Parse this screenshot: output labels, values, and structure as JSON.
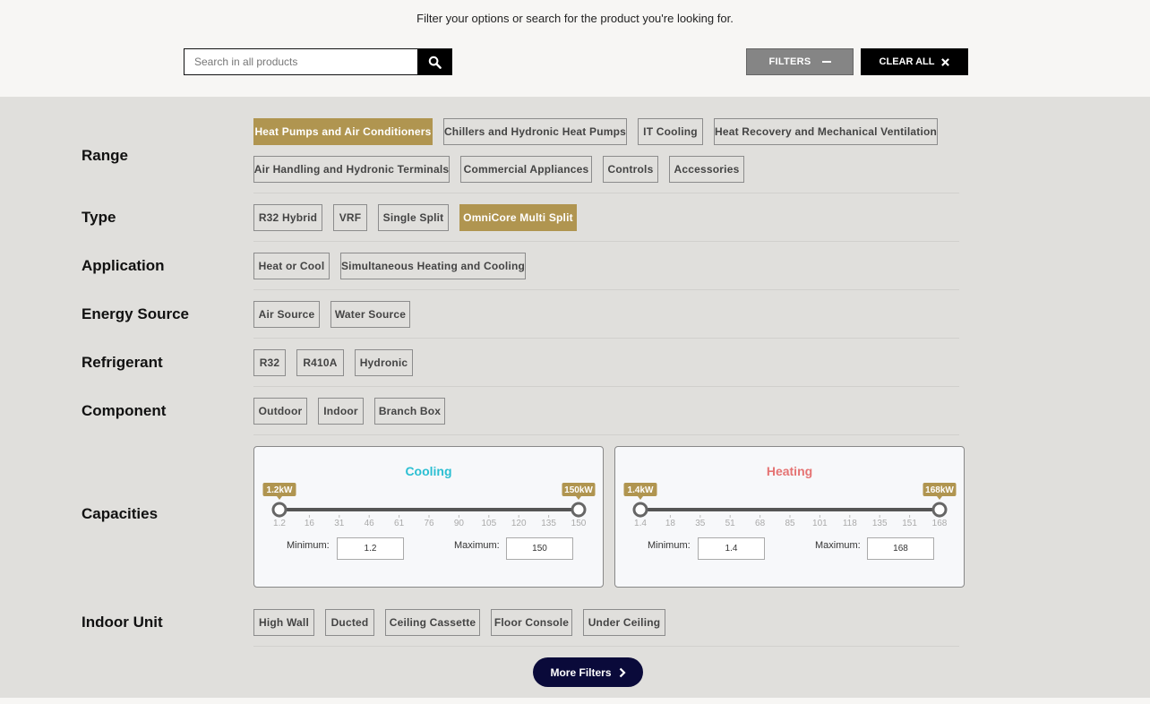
{
  "header": {
    "subtitle": "Filter your options or search for the product you're looking for.",
    "search_placeholder": "Search in all products",
    "search_icon": "search-icon",
    "filters_label": "FILTERS",
    "clear_all_label": "CLEAR ALL"
  },
  "filters": {
    "range": {
      "label": "Range",
      "options": [
        "Heat Pumps and Air Conditioners",
        "Chillers and Hydronic Heat Pumps",
        "IT Cooling",
        "Heat Recovery and Mechanical Ventilation",
        "Air Handling and Hydronic Terminals",
        "Commercial Appliances",
        "Controls",
        "Accessories"
      ],
      "selected": "Heat Pumps and Air Conditioners"
    },
    "type": {
      "label": "Type",
      "options": [
        "R32 Hybrid",
        "VRF",
        "Single Split",
        "OmniCore Multi Split"
      ],
      "selected": "OmniCore Multi Split"
    },
    "application": {
      "label": "Application",
      "options": [
        "Heat or Cool",
        "Simultaneous Heating and Cooling"
      ]
    },
    "energy_source": {
      "label": "Energy Source",
      "options": [
        "Air Source",
        "Water Source"
      ]
    },
    "refrigerant": {
      "label": "Refrigerant",
      "options": [
        "R32",
        "R410A",
        "Hydronic"
      ]
    },
    "component": {
      "label": "Component",
      "options": [
        "Outdoor",
        "Indoor",
        "Branch Box"
      ]
    },
    "capacities": {
      "label": "Capacities",
      "cooling": {
        "title": "Cooling",
        "min_badge": "1.2kW",
        "max_badge": "150kW",
        "ticks": [
          "1.2",
          "16",
          "31",
          "46",
          "61",
          "76",
          "90",
          "105",
          "120",
          "135",
          "150"
        ],
        "min_label": "Minimum:",
        "max_label": "Maximum:",
        "min_value": "1.2",
        "max_value": "150",
        "range_min": 1.2,
        "range_max": 150,
        "selected_min": 1.2,
        "selected_max": 150
      },
      "heating": {
        "title": "Heating",
        "min_badge": "1.4kW",
        "max_badge": "168kW",
        "ticks": [
          "1.4",
          "18",
          "35",
          "51",
          "68",
          "85",
          "101",
          "118",
          "135",
          "151",
          "168"
        ],
        "min_label": "Minimum:",
        "max_label": "Maximum:",
        "min_value": "1.4",
        "max_value": "168",
        "range_min": 1.4,
        "range_max": 168,
        "selected_min": 1.4,
        "selected_max": 168
      }
    },
    "indoor_unit": {
      "label": "Indoor Unit",
      "options": [
        "High Wall",
        "Ducted",
        "Ceiling Cassette",
        "Floor Console",
        "Under Ceiling"
      ]
    }
  },
  "more_filters_label": "More Filters",
  "colors": {
    "accent_gold": "#b09550",
    "cooling": "#2bbfd2",
    "heating": "#e57373",
    "more_button": "#0a0a3a"
  }
}
